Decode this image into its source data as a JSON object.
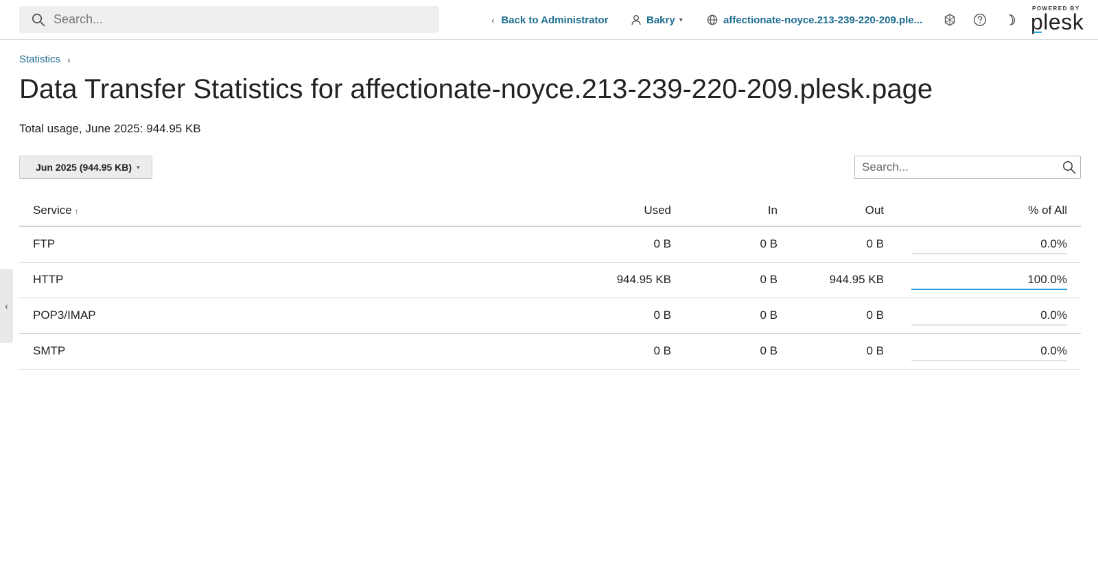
{
  "header": {
    "search_placeholder": "Search...",
    "back_label": "Back to Administrator",
    "user_name": "Bakry",
    "domain_label": "affectionate-noyce.213-239-220-209.ple...",
    "brand_powered_by": "POWERED BY",
    "brand_logo": "plesk",
    "icons": [
      "search-icon",
      "chevron-left-icon",
      "user-icon",
      "chevron-down-icon",
      "globe-icon",
      "puzzle-icon",
      "help-icon",
      "moon-icon"
    ]
  },
  "breadcrumb": {
    "items": [
      {
        "label": "Statistics"
      }
    ],
    "separator": "›"
  },
  "page": {
    "title": "Data Transfer Statistics for affectionate-noyce.213-239-220-209.plesk.page",
    "total_usage": "Total usage, June 2025: 944.95 KB"
  },
  "toolbar": {
    "period_label": "Jun 2025 (944.95 KB)",
    "search_placeholder": "Search..."
  },
  "table": {
    "columns": {
      "service": "Service",
      "used": "Used",
      "in": "In",
      "out": "Out",
      "pct": "% of All"
    },
    "sort_indicator": "↑",
    "rows": [
      {
        "service": "FTP",
        "used": "0 B",
        "in": "0 B",
        "out": "0 B",
        "pct": "0.0%",
        "pct_value": 0
      },
      {
        "service": "HTTP",
        "used": "944.95 KB",
        "in": "0 B",
        "out": "944.95 KB",
        "pct": "100.0%",
        "pct_value": 100
      },
      {
        "service": "POP3/IMAP",
        "used": "0 B",
        "in": "0 B",
        "out": "0 B",
        "pct": "0.0%",
        "pct_value": 0
      },
      {
        "service": "SMTP",
        "used": "0 B",
        "in": "0 B",
        "out": "0 B",
        "pct": "0.0%",
        "pct_value": 0
      }
    ]
  },
  "side_toggle": {
    "icon": "chevron-left-icon",
    "glyph": "‹"
  },
  "colors": {
    "link": "#1d6d8f",
    "progress_fill": "#28a0dc",
    "progress_track": "#e1e1e1",
    "brand_accent": "#28aade"
  }
}
